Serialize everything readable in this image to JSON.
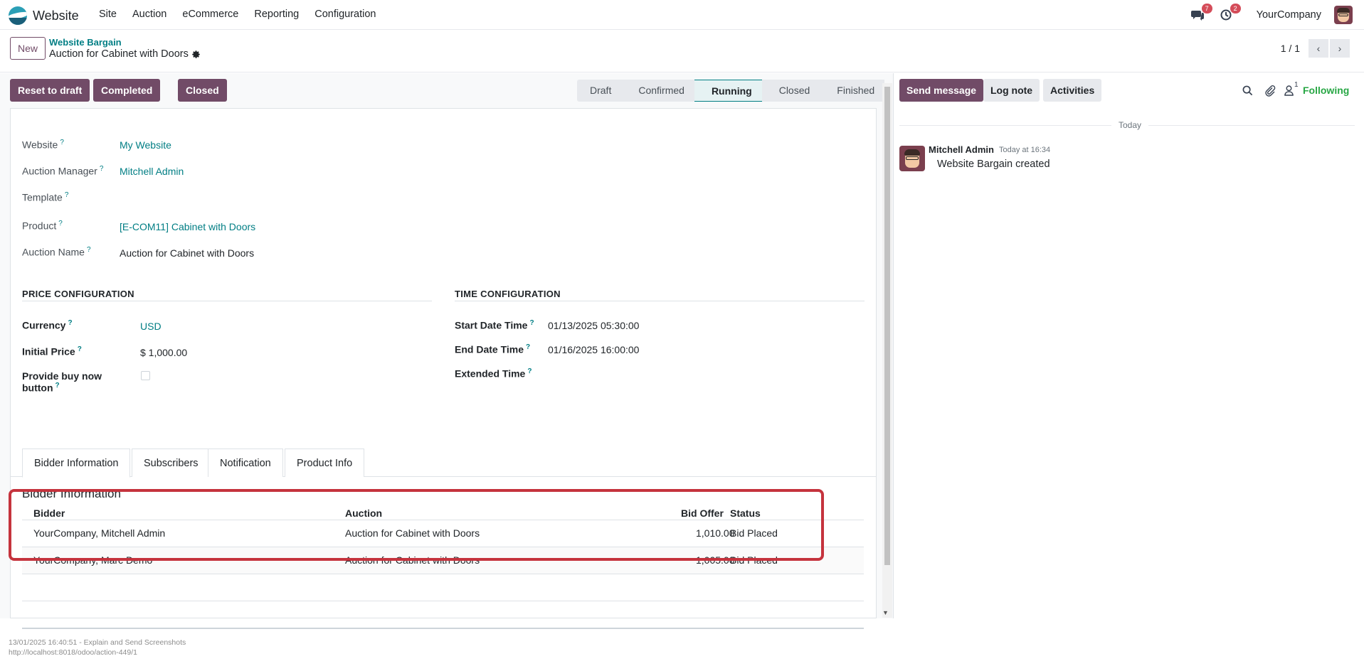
{
  "app": {
    "name": "Website"
  },
  "menu": [
    "Site",
    "Auction",
    "eCommerce",
    "Reporting",
    "Configuration"
  ],
  "nav": {
    "messages_count": "7",
    "activities_count": "2",
    "company": "YourCompany"
  },
  "control_panel": {
    "new_label": "New",
    "breadcrumb_parent": "Website Bargain",
    "breadcrumb_current": "Auction for Cabinet with Doors",
    "pager": "1 / 1"
  },
  "statusbar": {
    "buttons": [
      "Reset to draft",
      "Completed",
      "Closed"
    ],
    "stages": [
      "Draft",
      "Confirmed",
      "Running",
      "Closed",
      "Finished"
    ],
    "active_stage": "Running"
  },
  "form": {
    "website_label": "Website",
    "website_value": "My Website",
    "manager_label": "Auction Manager",
    "manager_value": "Mitchell Admin",
    "template_label": "Template",
    "product_label": "Product",
    "product_value": "[E-COM11] Cabinet with Doors",
    "auction_name_label": "Auction Name",
    "auction_name_value": "Auction for Cabinet with Doors",
    "price_section": "PRICE CONFIGURATION",
    "currency_label": "Currency",
    "currency_value": "USD",
    "initial_price_label": "Initial Price",
    "initial_price_value": "$ 1,000.00",
    "buy_now_label_1": "Provide buy now",
    "buy_now_label_2": "button",
    "time_section": "TIME CONFIGURATION",
    "start_label": "Start Date Time",
    "start_value": "01/13/2025 05:30:00",
    "end_label": "End Date Time",
    "end_value": "01/16/2025 16:00:00",
    "extended_label": "Extended Time",
    "help_mark": "?"
  },
  "tabs": [
    "Bidder Information",
    "Subscribers",
    "Notification",
    "Product Info"
  ],
  "bidder_section": {
    "title": "Bidder Information",
    "columns": [
      "Bidder",
      "Auction",
      "Bid Offer",
      "Status"
    ],
    "rows": [
      {
        "bidder": "YourCompany, Mitchell Admin",
        "auction": "Auction for Cabinet with Doors",
        "offer": "1,010.00",
        "status": "Bid Placed"
      },
      {
        "bidder": "YourCompany, Marc Demo",
        "auction": "Auction for Cabinet with Doors",
        "offer": "1,005.00",
        "status": "Bid Placed"
      }
    ]
  },
  "chatter": {
    "send_message": "Send message",
    "log_note": "Log note",
    "activities": "Activities",
    "followers_count": "1",
    "following": "Following",
    "date_separator": "Today",
    "message_author": "Mitchell Admin",
    "message_time": "Today at 16:34",
    "message_body": "Website Bargain created"
  },
  "footer": {
    "line1": "13/01/2025 16:40:51 - Explain and Send Screenshots",
    "line2": "http://localhost:8018/odoo/action-449/1"
  },
  "colors": {
    "primary": "#714b67",
    "link": "#017e84",
    "highlight": "#c5333d",
    "following": "#28a745"
  }
}
